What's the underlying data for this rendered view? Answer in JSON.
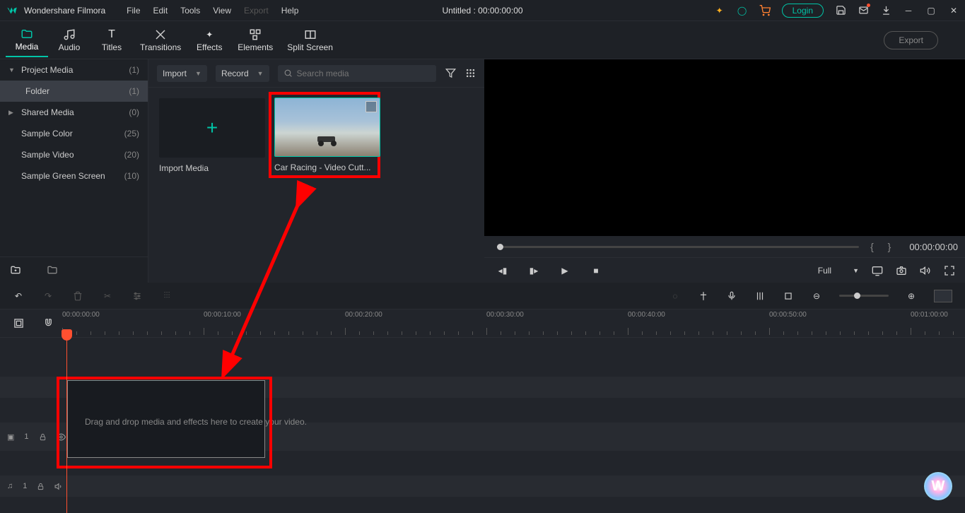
{
  "app_name": "Wondershare Filmora",
  "menubar": [
    "File",
    "Edit",
    "Tools",
    "View",
    "Export",
    "Help"
  ],
  "title_center": "Untitled : 00:00:00:00",
  "login_label": "Login",
  "tabs": [
    {
      "label": "Media",
      "active": true
    },
    {
      "label": "Audio",
      "active": false
    },
    {
      "label": "Titles",
      "active": false
    },
    {
      "label": "Transitions",
      "active": false
    },
    {
      "label": "Effects",
      "active": false
    },
    {
      "label": "Elements",
      "active": false
    },
    {
      "label": "Split Screen",
      "active": false
    }
  ],
  "export_pill": "Export",
  "sidebar": [
    {
      "label": "Project Media",
      "count": "(1)",
      "caret": "▼",
      "sub": false,
      "sel": false
    },
    {
      "label": "Folder",
      "count": "(1)",
      "caret": "",
      "sub": true,
      "sel": true
    },
    {
      "label": "Shared Media",
      "count": "(0)",
      "caret": "▶",
      "sub": false,
      "sel": false
    },
    {
      "label": "Sample Color",
      "count": "(25)",
      "caret": "",
      "sub": false,
      "sel": false,
      "nosub": true
    },
    {
      "label": "Sample Video",
      "count": "(20)",
      "caret": "",
      "sub": false,
      "sel": false,
      "nosub": true
    },
    {
      "label": "Sample Green Screen",
      "count": "(10)",
      "caret": "",
      "sub": false,
      "sel": false,
      "nosub": true
    }
  ],
  "media_top": {
    "import": "Import",
    "record": "Record",
    "search_placeholder": "Search media"
  },
  "media_items": [
    {
      "label": "Import Media",
      "type": "import"
    },
    {
      "label": "Car Racing - Video Cutt...",
      "type": "video",
      "highlight": true
    }
  ],
  "preview": {
    "time": "00:00:00:00",
    "full": "Full"
  },
  "ruler_marks": [
    "00:00:00:00",
    "00:00:10:00",
    "00:00:20:00",
    "00:00:30:00",
    "00:00:40:00",
    "00:00:50:00",
    "00:01:00:00"
  ],
  "drop_text": "Drag and drop media and effects here to create your video.",
  "track_video": "1",
  "track_audio": "1"
}
